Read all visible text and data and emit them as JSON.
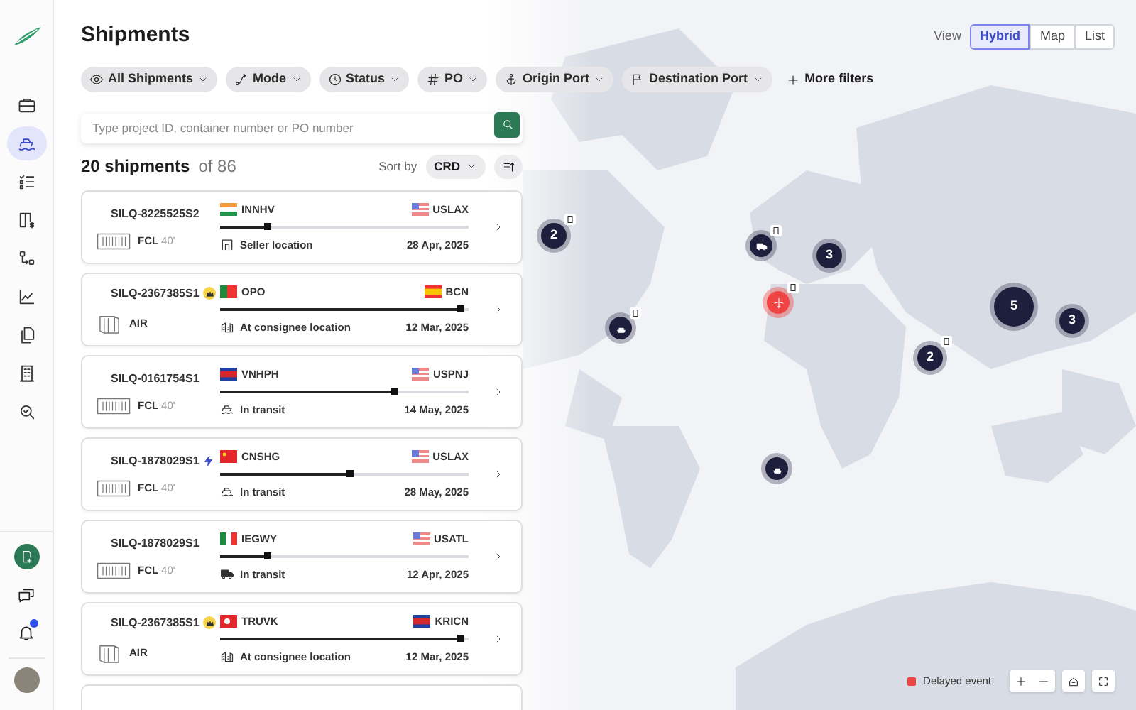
{
  "sidebar": {
    "items": [
      {
        "selected": false
      },
      {
        "selected": true
      },
      {
        "selected": false
      },
      {
        "selected": false
      },
      {
        "selected": false
      },
      {
        "selected": false
      },
      {
        "selected": false
      },
      {
        "selected": false
      },
      {
        "selected": false
      }
    ],
    "bottom": {
      "notifications": true
    }
  },
  "title": "Shipments",
  "view": {
    "label": "View",
    "options": [
      {
        "label": "Hybrid",
        "selected": true
      },
      {
        "label": "Map",
        "selected": false
      },
      {
        "label": "List",
        "selected": false
      }
    ]
  },
  "filters": [
    {
      "label": "All Shipments"
    },
    {
      "label": "Mode"
    },
    {
      "label": "Status"
    },
    {
      "label": "PO"
    },
    {
      "label": "Origin Port"
    },
    {
      "label": "Destination Port"
    }
  ],
  "more_filters": "More filters",
  "search": {
    "placeholder": "Type project ID, container number or PO number"
  },
  "count": {
    "shown": "20 shipments",
    "total": "of 86"
  },
  "sort": {
    "label": "Sort by",
    "value": "CRD"
  },
  "shipments": [
    {
      "id": "SILQ-8225525S2",
      "kind": "fcl",
      "mode": "FCL",
      "size": "40'",
      "origin": "INNHV",
      "destination": "USLAX",
      "level": 0.19,
      "status": "Seller location",
      "date": "28 Apr, 2025"
    },
    {
      "id": "SILQ-2367385S1",
      "kind": "air",
      "mode": "AIR",
      "origin": "OPO",
      "destination": "BCN",
      "level": 0.97,
      "status": "At consignee location",
      "date": "12 Mar, 2025"
    },
    {
      "id": "SILQ-0161754S1",
      "kind": "fcl",
      "mode": "FCL",
      "size": "40'",
      "origin": "VNHPH",
      "destination": "USPNJ",
      "level": 0.7,
      "status": "In transit",
      "date": "14 May, 2025"
    },
    {
      "id": "SILQ-1878029S1",
      "kind": "fcl",
      "mode": "FCL",
      "size": "40'",
      "origin": "CNSHG",
      "destination": "USLAX",
      "level": 0.52,
      "status": "In transit",
      "date": "28 May, 2025"
    },
    {
      "id": "SILQ-1878029S1",
      "kind": "fcl",
      "mode": "FCL",
      "size": "40'",
      "origin": "IEGWY",
      "destination": "USATL",
      "level": 0.19,
      "status": "In transit",
      "date": "12 Apr, 2025"
    },
    {
      "id": "SILQ-2367385S1",
      "kind": "air",
      "mode": "AIR",
      "origin": "TRUVK",
      "destination": "KRICN",
      "level": 0.97,
      "status": "At consignee location",
      "date": "12 Mar, 2025"
    }
  ],
  "map": {
    "markers": [
      {
        "kind": "cluster",
        "count": "2",
        "delayed": false
      },
      {
        "kind": "single",
        "delayed": false
      },
      {
        "kind": "cluster",
        "count": "3",
        "delayed": false
      },
      {
        "kind": "single",
        "delayed": true
      },
      {
        "kind": "cluster",
        "count": "5",
        "delayed": false
      },
      {
        "kind": "cluster",
        "count": "3",
        "delayed": false
      },
      {
        "kind": "single",
        "delayed": false
      },
      {
        "kind": "cluster",
        "count": "2",
        "delayed": false
      },
      {
        "kind": "single",
        "delayed": false
      }
    ],
    "legend": {
      "label": "Delayed event",
      "color": "#ef4444"
    }
  }
}
